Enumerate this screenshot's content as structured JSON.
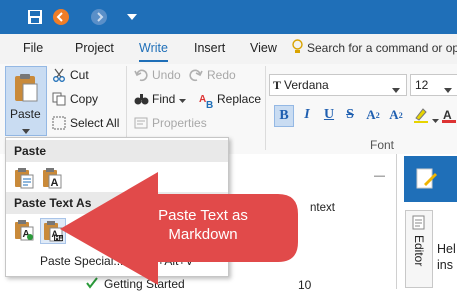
{
  "quick_access": {
    "icons": [
      "save-icon",
      "back-icon",
      "forward-icon",
      "customize-dropdown-icon"
    ]
  },
  "tabs": [
    "File",
    "Project",
    "Write",
    "Insert",
    "View"
  ],
  "active_tab": "Write",
  "search": {
    "placeholder": "Search for a command or op"
  },
  "ribbon": {
    "paste": {
      "label": "Paste"
    },
    "cut": "Cut",
    "copy": "Copy",
    "select_all": "Select All",
    "undo": "Undo",
    "redo": "Redo",
    "properties": "Properties",
    "find": "Find",
    "replace": "Replace",
    "font_name": "Verdana",
    "font_size": "12",
    "font_group_label": "Font",
    "font_icon_glyph": "T"
  },
  "paste_menu": {
    "section_paste": "Paste",
    "section_paste_text_as": "Paste Text As",
    "paste_special": "Paste Special...",
    "paste_special_shortcut": "+Alt+V"
  },
  "callout": {
    "text_line1": "Paste Text as",
    "text_line2": "Markdown"
  },
  "background": {
    "panel_header_fragment": "ntext",
    "pin_glyph": "―",
    "tree_item": "Getting Started",
    "tree_item_value": "10",
    "side_tab_label": "Editor",
    "help_fragment_1": "Hel",
    "help_fragment_2": "ins"
  },
  "colors": {
    "accent": "#1f6fb8",
    "callout": "#e14a4a"
  }
}
